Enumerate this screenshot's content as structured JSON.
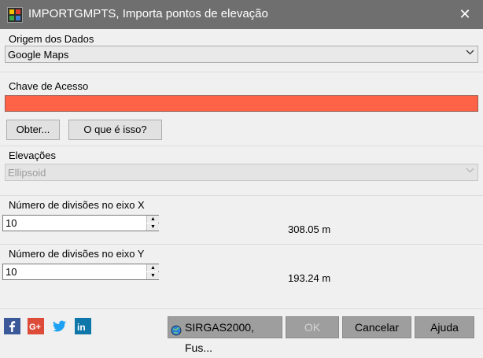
{
  "window": {
    "title": "IMPORTGMPTS, Importa pontos de elevação",
    "close_glyph": "✕"
  },
  "origem": {
    "label": "Origem dos Dados",
    "selected": "Google Maps"
  },
  "chave": {
    "label": "Chave de Acesso",
    "value": "",
    "color": "#ff6347",
    "obter_label": "Obter...",
    "whats_label": "O que é isso?"
  },
  "elevacoes": {
    "label": "Elevações",
    "selected": "Ellipsoid"
  },
  "div_x": {
    "label": "Número de divisões no eixo X",
    "value": "10",
    "measure": "308.05 m"
  },
  "div_y": {
    "label": "Número de divisões no eixo Y",
    "value": "10",
    "measure": "193.24 m"
  },
  "footer": {
    "social": [
      "facebook-icon",
      "google-plus-icon",
      "twitter-icon",
      "linkedin-icon"
    ],
    "crs_label": "SIRGAS2000, Fus...",
    "ok_label": "OK",
    "cancel_label": "Cancelar",
    "help_label": "Ajuda"
  }
}
